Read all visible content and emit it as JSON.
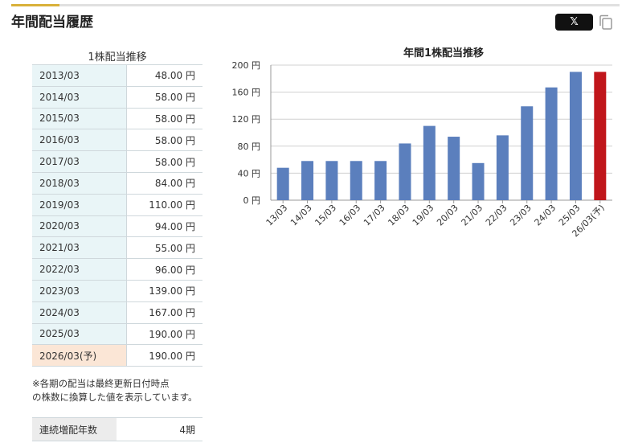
{
  "header": {
    "title": "年間配当履歴",
    "share_label": "𝕏"
  },
  "table": {
    "caption": "1株配当推移",
    "rows": [
      {
        "year": "2013/03",
        "value": "48.00 円"
      },
      {
        "year": "2014/03",
        "value": "58.00 円"
      },
      {
        "year": "2015/03",
        "value": "58.00 円"
      },
      {
        "year": "2016/03",
        "value": "58.00 円"
      },
      {
        "year": "2017/03",
        "value": "58.00 円"
      },
      {
        "year": "2018/03",
        "value": "84.00 円"
      },
      {
        "year": "2019/03",
        "value": "110.00 円"
      },
      {
        "year": "2020/03",
        "value": "94.00 円"
      },
      {
        "year": "2021/03",
        "value": "55.00 円"
      },
      {
        "year": "2022/03",
        "value": "96.00 円"
      },
      {
        "year": "2023/03",
        "value": "139.00 円"
      },
      {
        "year": "2024/03",
        "value": "167.00 円"
      },
      {
        "year": "2025/03",
        "value": "190.00 円"
      },
      {
        "year": "2026/03(予)",
        "value": "190.00 円"
      }
    ],
    "note_line1": "※各期の配当は最終更新日付時点",
    "note_line2": "の株数に換算した値を表示しています。",
    "streak_label": "連続増配年数",
    "streak_value": "4期"
  },
  "colors": {
    "bar": "#5b7fbd",
    "forecast_bar": "#c0161b",
    "accent": "#d9b13a"
  },
  "icons": {
    "share": "x-logo-icon",
    "copy": "copy-icon"
  },
  "chart_data": {
    "type": "bar",
    "title": "年間1株配当推移",
    "categories": [
      "13/03",
      "14/03",
      "15/03",
      "16/03",
      "17/03",
      "18/03",
      "19/03",
      "20/03",
      "21/03",
      "22/03",
      "23/03",
      "24/03",
      "25/03",
      "26/03(予)"
    ],
    "values": [
      48,
      58,
      58,
      58,
      58,
      84,
      110,
      94,
      55,
      96,
      139,
      167,
      190,
      190
    ],
    "forecast_index": 13,
    "ylim": [
      0,
      200
    ],
    "yticks": [
      "0 円",
      "40 円",
      "80 円",
      "120 円",
      "160 円",
      "200 円"
    ],
    "grid": true
  }
}
